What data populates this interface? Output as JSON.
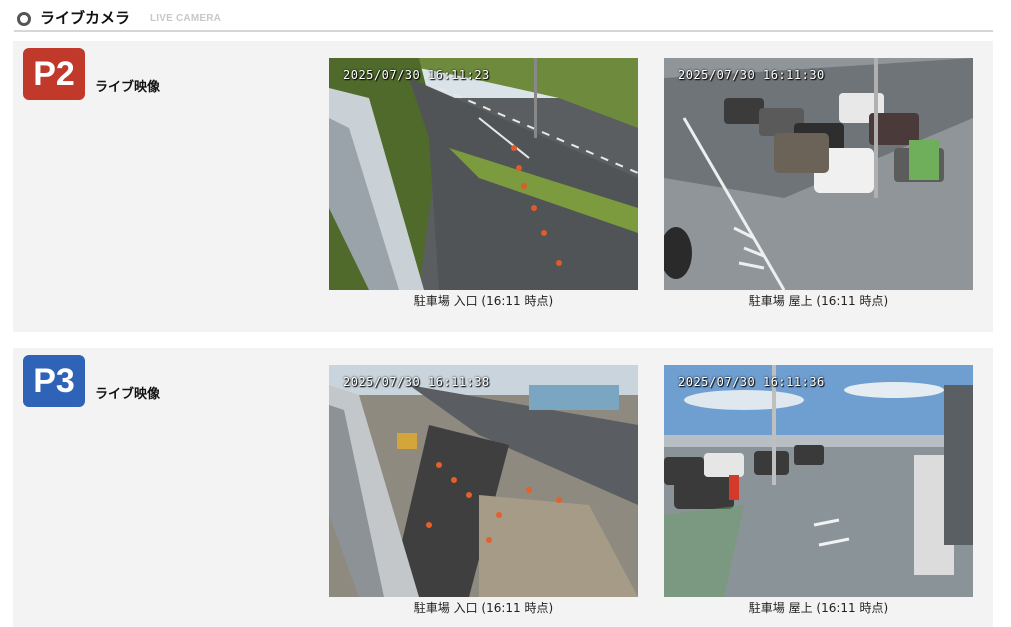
{
  "header": {
    "title": "ライブカメラ",
    "subtitle": "LIVE CAMERA",
    "icon": "ring-bullet-icon"
  },
  "panels": [
    {
      "badge": "P2",
      "badge_color": "#c0392b",
      "label": "ライブ映像",
      "cameras": [
        {
          "timestamp": "2025/07/30 16:11:23",
          "caption": "駐車場 入口 (16:11 時点)"
        },
        {
          "timestamp": "2025/07/30 16:11:30",
          "caption": "駐車場 屋上 (16:11 時点)"
        }
      ]
    },
    {
      "badge": "P3",
      "badge_color": "#2f63b8",
      "label": "ライブ映像",
      "cameras": [
        {
          "timestamp": "2025/07/30 16:11:38",
          "caption": "駐車場 入口 (16:11 時点)"
        },
        {
          "timestamp": "2025/07/30 16:11:36",
          "caption": "駐車場 屋上 (16:11 時点)"
        }
      ]
    }
  ]
}
